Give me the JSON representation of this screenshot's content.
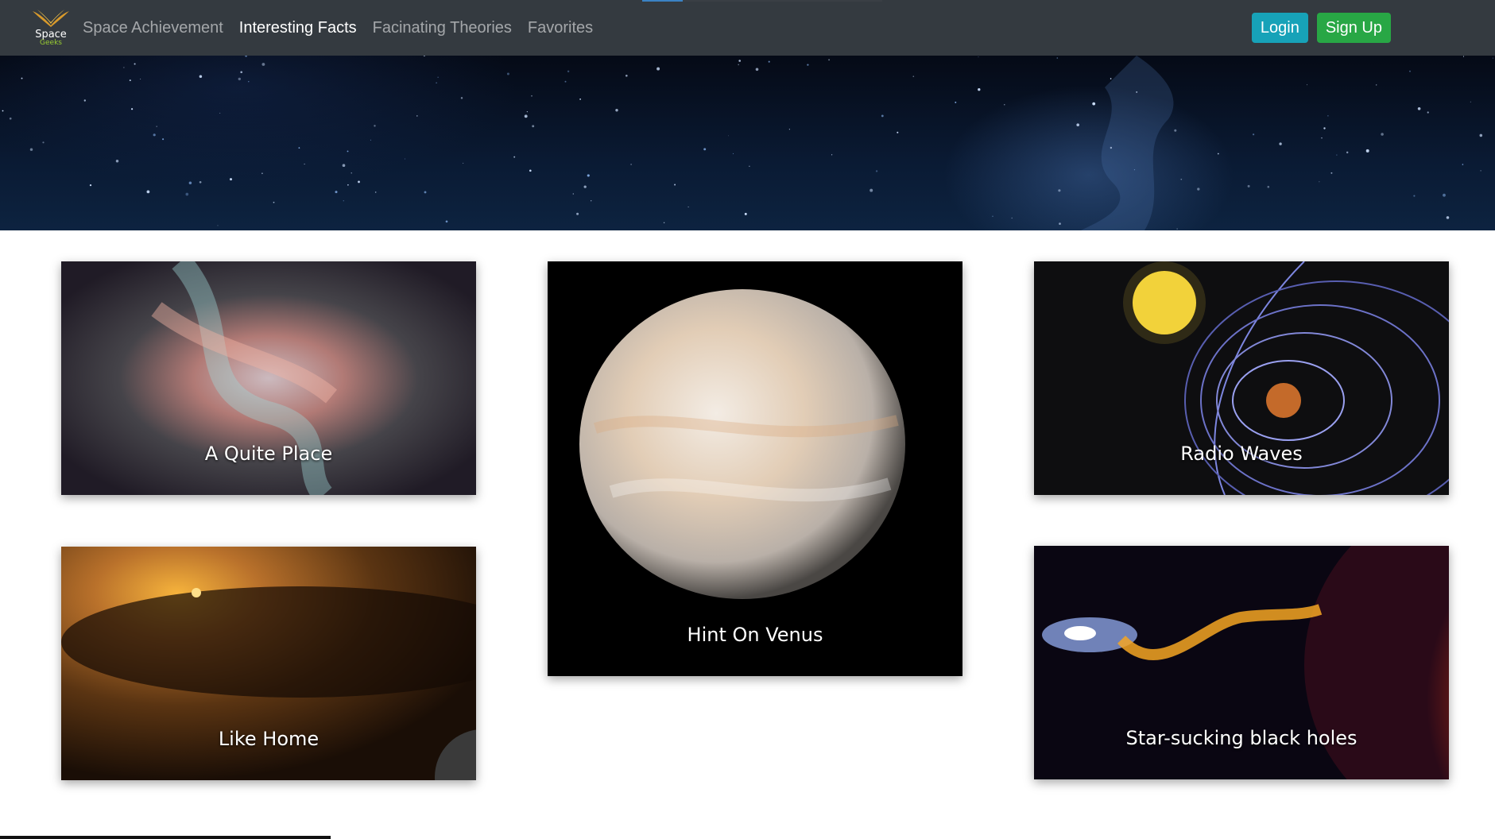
{
  "page_progress": 0.17,
  "brand": {
    "name": "Space",
    "sub": "Geeks",
    "icon": "winged-logo-icon"
  },
  "nav": {
    "links": [
      {
        "label": "Space Achievement",
        "active": false
      },
      {
        "label": "Interesting Facts",
        "active": true
      },
      {
        "label": "Facinating Theories",
        "active": false
      },
      {
        "label": "Favorites",
        "active": false
      }
    ],
    "login_label": "Login",
    "signup_label": "Sign Up"
  },
  "colors": {
    "navbar": "#343a40",
    "login": "#17a2b8",
    "signup": "#28a745"
  },
  "cards": [
    {
      "title": "A Quite Place",
      "image": "magnetic-field-nebula-image"
    },
    {
      "title": "Hint On Venus",
      "image": "venus-planet-image"
    },
    {
      "title": "Radio Waves",
      "image": "planet-magnetosphere-image"
    },
    {
      "title": "Like Home",
      "image": "asteroid-belt-star-system-image"
    },
    {
      "title": "Star-sucking black holes",
      "image": "black-hole-red-star-image"
    }
  ]
}
